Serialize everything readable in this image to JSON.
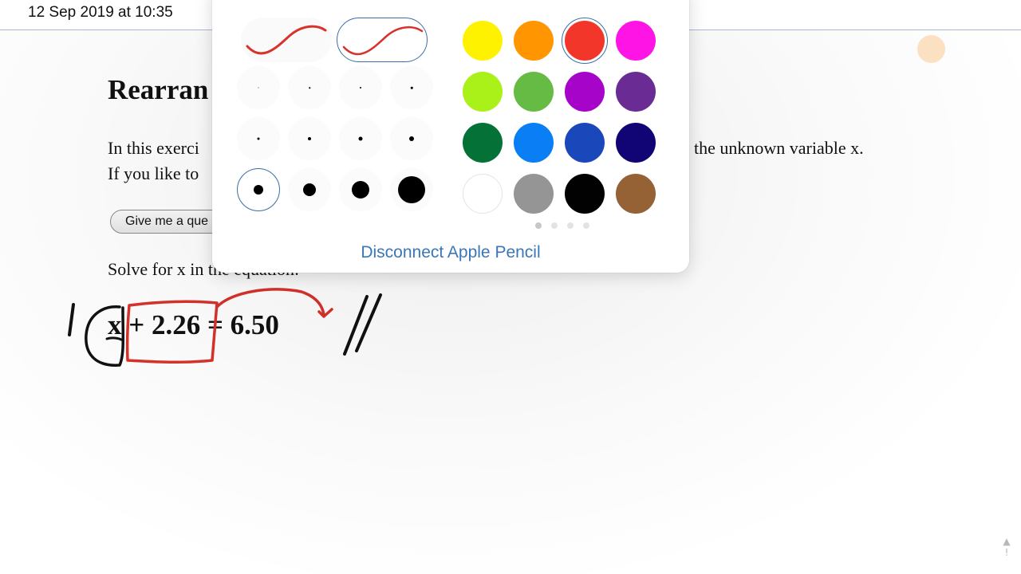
{
  "header": {
    "date_text": "12 Sep 2019 at 10:35"
  },
  "document": {
    "title": "Rearran",
    "intro_line1_start": "In this exerci",
    "intro_line1_end": "the unknown variable x.",
    "intro_line2_start": "If you like to",
    "question_button_label": "Give me a que",
    "solve_prompt": "Solve for x in the equation:",
    "equation": "x + 2.26 = 6.50"
  },
  "pencil_popover": {
    "disconnect_label": "Disconnect Apple Pencil",
    "stroke_styles": [
      "stroke-style-thin-red",
      "stroke-style-tapered-red"
    ],
    "selected_stroke_style": 1,
    "selected_size_index": 8,
    "selected_color_index": 2,
    "colors": [
      {
        "name": "yellow",
        "hex": "#FFF200"
      },
      {
        "name": "orange",
        "hex": "#FF9500"
      },
      {
        "name": "red",
        "hex": "#F2362A"
      },
      {
        "name": "magenta",
        "hex": "#FF14E6"
      },
      {
        "name": "lime",
        "hex": "#AAF019"
      },
      {
        "name": "green",
        "hex": "#66BB45"
      },
      {
        "name": "purple",
        "hex": "#A605C9"
      },
      {
        "name": "violet",
        "hex": "#6A2B95"
      },
      {
        "name": "dark-green",
        "hex": "#047237"
      },
      {
        "name": "sky-blue",
        "hex": "#0A7EF5"
      },
      {
        "name": "royal-blue",
        "hex": "#1A47BA"
      },
      {
        "name": "navy",
        "hex": "#110575"
      },
      {
        "name": "white",
        "hex": "#FFFFFF"
      },
      {
        "name": "gray",
        "hex": "#959595"
      },
      {
        "name": "black",
        "hex": "#020202"
      },
      {
        "name": "brown",
        "hex": "#946234"
      }
    ],
    "active_page": 0,
    "page_count": 4
  },
  "ink_colors": {
    "red": "#D8322B",
    "black": "#111111"
  }
}
